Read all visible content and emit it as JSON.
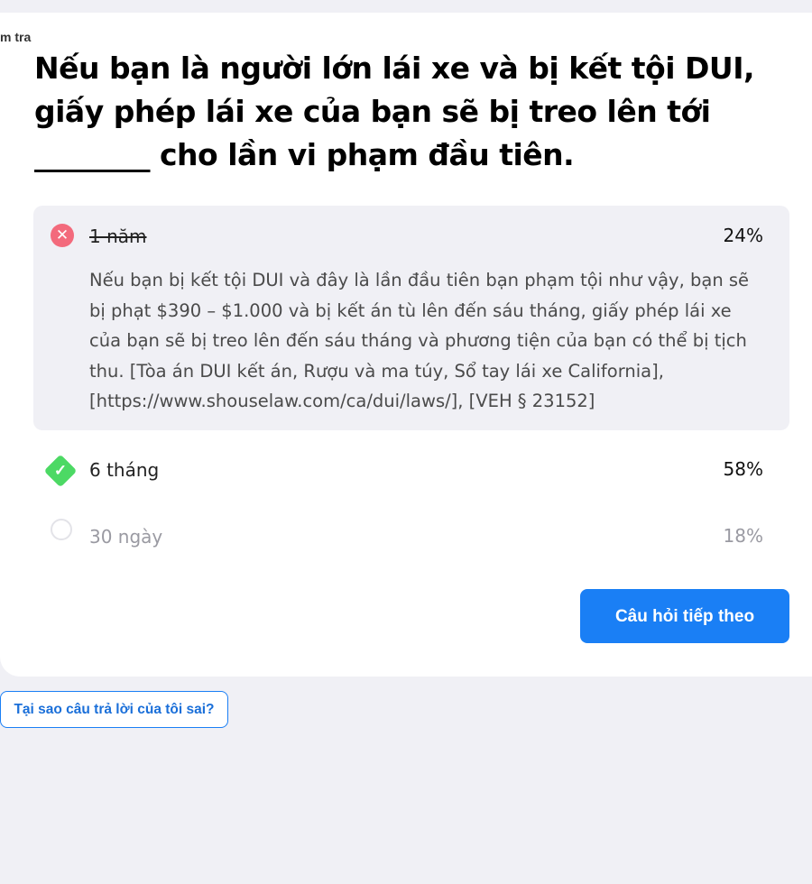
{
  "header": {
    "cut_label": "m tra"
  },
  "question": {
    "line1": "Nếu bạn là người lớn lái xe và bị kết tội DUI,",
    "line2": "giấy phép lái xe của bạn sẽ bị treo lên tới",
    "line3": "________ cho lần vi phạm đầu tiên."
  },
  "answers": [
    {
      "label": "1 năm",
      "percent": "24%",
      "state": "wrong",
      "explanation": "Nếu bạn bị kết tội DUI và đây là lần đầu tiên bạn phạm tội như vậy, bạn sẽ bị phạt $390 – $1.000 và bị kết án tù lên đến sáu tháng, giấy phép lái xe của bạn sẽ bị treo lên đến sáu tháng và phương tiện của bạn có thể bị tịch thu. [Tòa án DUI kết án, Rượu và ma túy, Sổ tay lái xe California], [https://www.shouselaw.com/ca/dui/laws/], [VEH § 23152]"
    },
    {
      "label": "6 tháng",
      "percent": "58%",
      "state": "correct"
    },
    {
      "label": "30 ngày",
      "percent": "18%",
      "state": "unselected"
    }
  ],
  "buttons": {
    "next": "Câu hỏi tiếp theo",
    "why_wrong": "Tại sao câu trả lời của tôi sai?"
  },
  "colors": {
    "accent": "#1a7ff5",
    "wrong": "#f36a7c",
    "correct": "#4cd964",
    "background": "#f0f0f5"
  },
  "icons": {
    "wrong": "x-circle-icon",
    "correct": "check-diamond-icon",
    "unselected": "empty-circle-icon"
  }
}
